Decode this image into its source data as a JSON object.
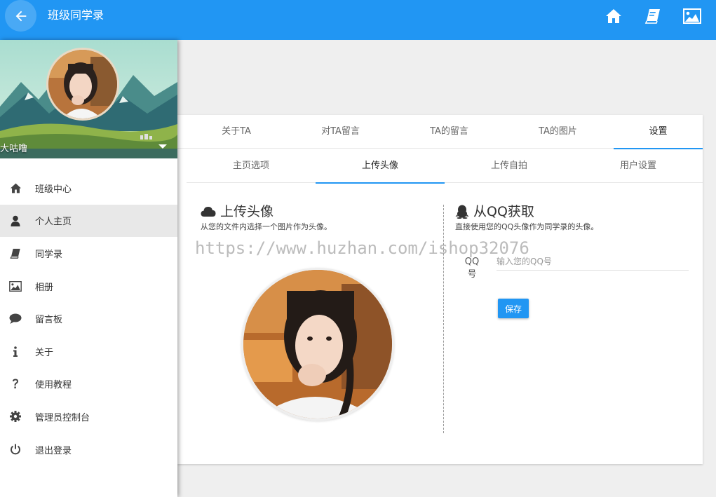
{
  "header": {
    "title": "班级同学录",
    "back_icon": "arrow-left-icon",
    "icons": [
      "home-icon",
      "book-icon",
      "image-icon"
    ],
    "background": "#2196f3"
  },
  "sidebar": {
    "username": "大咕噜",
    "menu": [
      {
        "label": "班级中心",
        "icon": "home-icon",
        "active": false
      },
      {
        "label": "个人主页",
        "icon": "user-icon",
        "active": true
      },
      {
        "label": "同学录",
        "icon": "book-icon",
        "active": false
      },
      {
        "label": "相册",
        "icon": "image-icon",
        "active": false
      },
      {
        "label": "留言板",
        "icon": "comment-icon",
        "active": false
      },
      {
        "label": "关于",
        "icon": "info-icon",
        "active": false
      },
      {
        "label": "使用教程",
        "icon": "question-icon",
        "active": false
      },
      {
        "label": "管理员控制台",
        "icon": "gear-icon",
        "active": false
      },
      {
        "label": "退出登录",
        "icon": "power-icon",
        "active": false
      }
    ]
  },
  "tabs": [
    {
      "label": "关于TA",
      "active": false
    },
    {
      "label": "对TA留言",
      "active": false
    },
    {
      "label": "TA的留言",
      "active": false
    },
    {
      "label": "TA的图片",
      "active": false
    },
    {
      "label": "设置",
      "active": true
    }
  ],
  "subtabs": [
    {
      "label": "主页选项",
      "active": false
    },
    {
      "label": "上传头像",
      "active": true
    },
    {
      "label": "上传自拍",
      "active": false
    },
    {
      "label": "用户设置",
      "active": false
    }
  ],
  "upload": {
    "title": "上传头像",
    "icon": "cloud-icon",
    "desc": "从您的文件内选择一个图片作为头像。"
  },
  "qq": {
    "title": "从QQ获取",
    "icon": "qq-penguin-icon",
    "desc": "直接使用您的QQ头像作为同学录的头像。",
    "label": "QQ号",
    "placeholder": "输入您的QQ号",
    "value": "",
    "save_label": "保存"
  },
  "watermark": "https://www.huzhan.com/ishop32076",
  "accent": "#2196f3"
}
